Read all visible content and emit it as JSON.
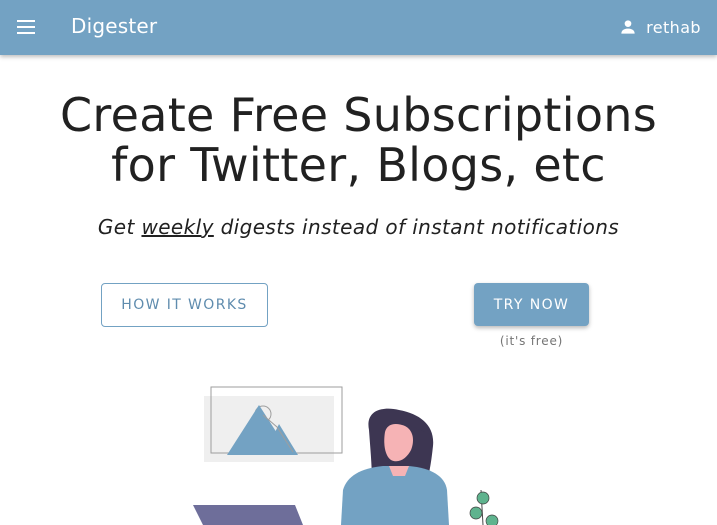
{
  "appbar": {
    "title": "Digester",
    "user_name": "rethab",
    "menu_icon": "menu-icon",
    "user_icon": "account-icon",
    "color": "#73a2c3"
  },
  "hero": {
    "title_line1": "Create Free Subscriptions",
    "title_line2": "for Twitter, Blogs, etc",
    "subtitle_prefix": "Get ",
    "subtitle_emphasis": "weekly",
    "subtitle_suffix": " digests instead of instant notifications"
  },
  "actions": {
    "how_it_works_label": "HOW IT WORKS",
    "try_now_label": "TRY NOW",
    "free_note": "(it's free)"
  },
  "illustration": {
    "description_icon": "person-with-picture-illustration",
    "accent_color": "#73a2c3"
  }
}
